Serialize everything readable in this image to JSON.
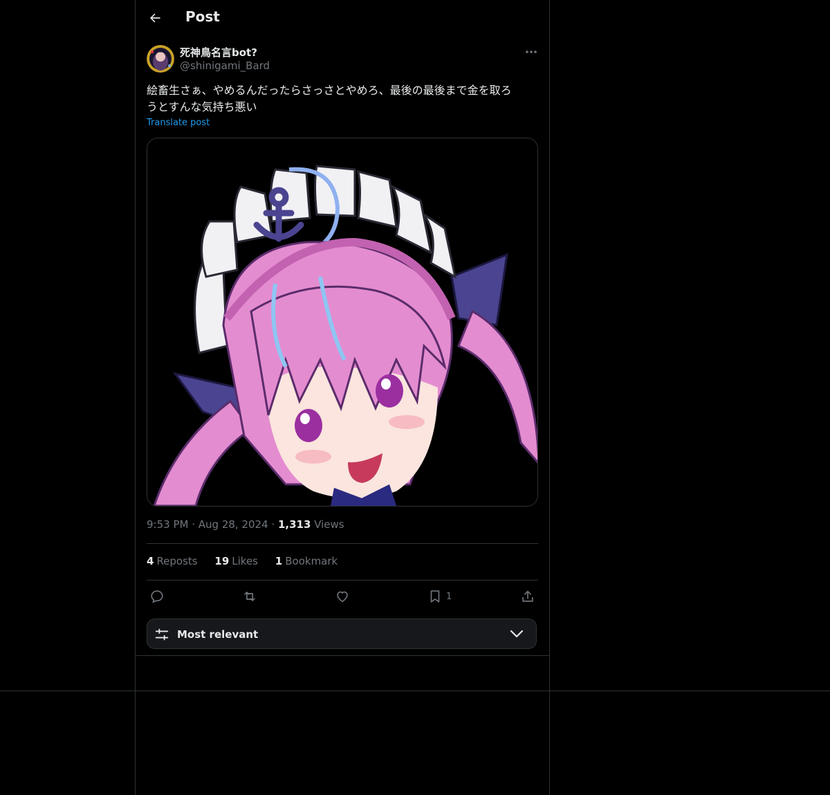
{
  "header": {
    "title": "Post",
    "back_icon": "arrow-left-icon"
  },
  "author": {
    "display_name": "死神鳥名言bot?",
    "handle": "@shinigami_Bard",
    "more_icon": "more-horizontal-icon"
  },
  "tweet": {
    "text_line1": "絵畜生さぁ、やめるんだったらさっさとやめろ、最後の最後まで金を取ろ",
    "text_line2": "うとすんな気持ち悪い",
    "translate_label": "Translate post",
    "time": "9:53 PM",
    "date": "Aug 28, 2024",
    "views_count": "1,313",
    "views_label": "Views"
  },
  "stats": {
    "reposts_count": "4",
    "reposts_label": "Reposts",
    "likes_count": "19",
    "likes_label": "Likes",
    "bookmarks_count": "1",
    "bookmarks_label": "Bookmark"
  },
  "actions": {
    "reply_icon": "reply-icon",
    "repost_icon": "repost-icon",
    "like_icon": "heart-icon",
    "bookmark_icon": "bookmark-icon",
    "bookmark_count": "1",
    "share_icon": "share-icon"
  },
  "sort": {
    "label": "Most relevant",
    "icon": "sliders-icon",
    "chevron": "chevron-down-icon"
  },
  "colors": {
    "background": "#000000",
    "text": "#e7e9ea",
    "muted": "#71767b",
    "link": "#1d9bf0",
    "border": "#2f3336"
  }
}
